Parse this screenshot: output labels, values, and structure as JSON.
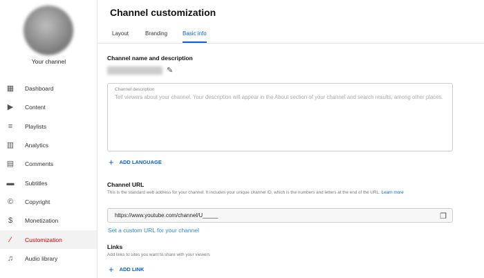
{
  "sidebar": {
    "channel_label": "Your channel",
    "items": [
      {
        "label": "Dashboard",
        "icon": "dashboard-icon"
      },
      {
        "label": "Content",
        "icon": "content-icon"
      },
      {
        "label": "Playlists",
        "icon": "playlists-icon"
      },
      {
        "label": "Analytics",
        "icon": "analytics-icon"
      },
      {
        "label": "Comments",
        "icon": "comments-icon"
      },
      {
        "label": "Subtitles",
        "icon": "subtitles-icon"
      },
      {
        "label": "Copyright",
        "icon": "copyright-icon"
      },
      {
        "label": "Monetization",
        "icon": "dollar-icon"
      },
      {
        "label": "Customization",
        "icon": "magic-wand-icon",
        "active": true
      },
      {
        "label": "Audio library",
        "icon": "audio-library-icon"
      }
    ]
  },
  "header": {
    "title": "Channel customization",
    "tabs": [
      {
        "label": "Layout"
      },
      {
        "label": "Branding"
      },
      {
        "label": "Basic info",
        "active": true
      }
    ]
  },
  "basic_info": {
    "name_section": "Channel name and description",
    "description_label": "Channel description",
    "description_placeholder": "Tell viewers about your channel. Your description will appear in the About section of your channel and search results, among other places.",
    "add_language": "ADD LANGUAGE",
    "url_heading": "Channel URL",
    "url_help": "This is the standard web address for your channel. It includes your unique channel ID, which is the numbers and letters at the end of the URL.",
    "learn_more": "Learn more",
    "url_value": "https://www.youtube.com/channel/U_____",
    "custom_url": "Set a custom URL for your channel",
    "links_heading": "Links",
    "links_help": "Add links to sites you want to share with your viewers",
    "add_link": "ADD LINK"
  },
  "colors": {
    "accent": "#065fd4",
    "active_nav": "#cc0000"
  }
}
